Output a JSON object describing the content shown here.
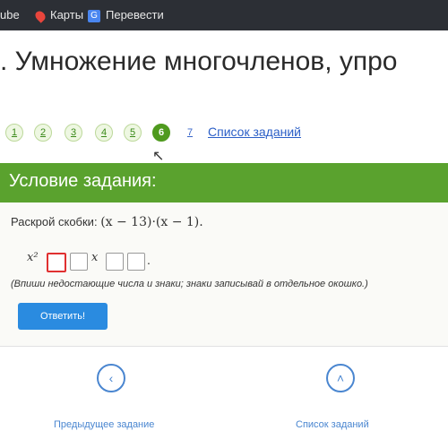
{
  "browser": {
    "bookmarks": [
      {
        "label": "ube",
        "icon": "youtube-icon"
      },
      {
        "label": "Карты",
        "icon": "maps-pin-icon"
      },
      {
        "label": "Перевести",
        "icon": "translate-icon"
      }
    ]
  },
  "page": {
    "title": ". Умножение многочленов, упро"
  },
  "pager": {
    "items": [
      "1",
      "2",
      "3",
      "4",
      "5",
      "6",
      "7"
    ],
    "current": "6",
    "task_list_label": "Список заданий"
  },
  "task": {
    "header": "Условие задания:",
    "instruction_prefix": "Раскрой скобки:",
    "expression": "(x − 13)·(x − 1).",
    "answer_template": {
      "first_term": "x²",
      "middle_term": "x",
      "end_dot": "."
    },
    "hint": "(Впиши недостающие числа и знаки; знаки записывай в отдельное окошко.)",
    "submit_label": "Ответить!"
  },
  "footer": {
    "prev_label": "Предыдущее задание",
    "list_label": "Список заданий",
    "prev_icon": "chevron-left-icon",
    "list_icon": "chevron-up-icon"
  },
  "colors": {
    "accent_green": "#5aa22e",
    "current_page_green": "#4f9a1e",
    "link_blue": "#2b5fc7",
    "button_blue": "#2a8be0",
    "focus_red": "#e03030"
  }
}
